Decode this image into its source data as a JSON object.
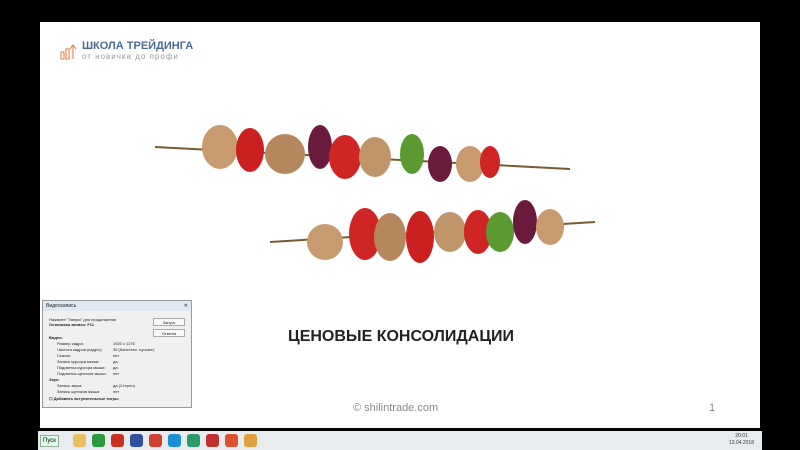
{
  "logo": {
    "title": "ШКОЛА ТРЕЙДИНГА",
    "subtitle": "от новичка до профи"
  },
  "slide": {
    "title": "ЦЕНОВЫЕ КОНСОЛИДАЦИИ",
    "footer": "© shilintrade.com",
    "page": "1"
  },
  "dialog": {
    "title": "Видеозапись",
    "hint": "Нажмите \"Запуск\" для продолжения",
    "stop": "Остановка записи: F11",
    "start_btn": "Запуск",
    "cancel_btn": "Отмена",
    "video_header": "Видео:",
    "rows": [
      [
        "Размер кадра:",
        "1920 x 1176"
      ],
      [
        "Частота кадров (кадр/с):",
        "30 (Качество: лучшее)"
      ],
      [
        "Скачок:",
        "нет"
      ],
      [
        "Запись курсора мыши:",
        "да"
      ],
      [
        "Подсветка курсора мыши:",
        "да"
      ],
      [
        "Подсветка щелчков мыши:",
        "нет"
      ]
    ],
    "audio_header": "Звук:",
    "audio_rows": [
      [
        "Запись звука:",
        "да (Стерео)"
      ],
      [
        "Запись щелчков мыши:",
        "нет"
      ]
    ],
    "intro_checkbox": "Добавить вступительные титры"
  },
  "taskbar": {
    "start": "Пуск",
    "time": "20:01",
    "date": "13.04.2018",
    "icons": [
      "folder-icon",
      "utorrent-icon",
      "app-icon",
      "save-icon",
      "chrome-icon",
      "skype-icon",
      "search-app-icon",
      "chrome-alt-icon",
      "presentation-icon",
      "media-icon"
    ],
    "icon_colors": [
      "#e8c060",
      "#2a9a3a",
      "#c83020",
      "#3050a0",
      "#d04030",
      "#1a90d8",
      "#2a9a6a",
      "#c03030",
      "#e05030",
      "#e0a040"
    ]
  }
}
